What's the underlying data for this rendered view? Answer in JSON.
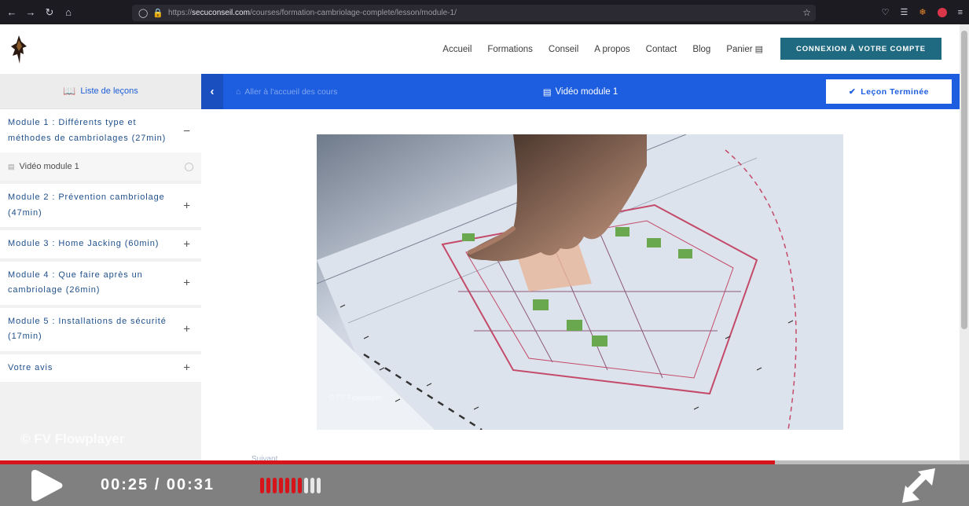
{
  "browser": {
    "url_domain": "secuconseil.com",
    "url_path": "/courses/formation-cambriolage-complete/lesson/module-1/"
  },
  "header": {
    "nav": [
      "Accueil",
      "Formations",
      "Conseil",
      "A propos",
      "Contact",
      "Blog",
      "Panier"
    ],
    "login_label": "CONNEXION À VOTRE COMPTE"
  },
  "sidebar": {
    "heading": "Liste de leçons",
    "modules": [
      {
        "title": "Module 1 : Différents type et méthodes de cambriolages (27min)",
        "state": "open"
      },
      {
        "title": "Module 2 : Prévention cambriolage (47min)",
        "state": "closed"
      },
      {
        "title": "Module 3 : Home Jacking (60min)",
        "state": "closed"
      },
      {
        "title": "Module 4 : Que faire après un cambriolage (26min)",
        "state": "closed"
      },
      {
        "title": "Module 5 : Installations de sécurité (17min)",
        "state": "closed"
      },
      {
        "title": "Votre avis",
        "state": "closed"
      }
    ],
    "lesson": "Vidéo module 1"
  },
  "lesson_bar": {
    "back_label": "Aller à l'accueil des cours",
    "title": "Vidéo module 1",
    "done_label": "Leçon Terminée"
  },
  "content": {
    "video_watermark": "© FV Flowplayer",
    "next_label": "Suivant"
  },
  "player": {
    "watermark": "© FV Flowplayer",
    "time": "00:25 / 00:31",
    "progress": 0.8,
    "volume_level": 7,
    "volume_max": 10,
    "accent": "#d7141a"
  },
  "icons": {
    "toggle_open": "−",
    "toggle_closed": "+",
    "check": "✔",
    "chevron_left": "‹",
    "cart": "🛒"
  }
}
